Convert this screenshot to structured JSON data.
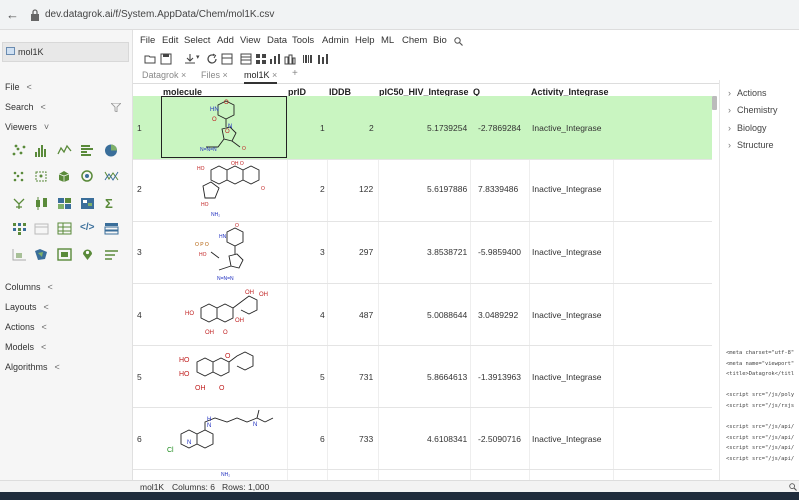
{
  "browser": {
    "url": "dev.datagrok.ai/f/System.AppData/Chem/mol1K.csv"
  },
  "left": {
    "doc_title": "mol1K",
    "sections": {
      "file": "File",
      "search": "Search",
      "viewers": "Viewers",
      "columns": "Columns",
      "layouts": "Layouts",
      "actions": "Actions",
      "models": "Models",
      "algorithms": "Algorithms"
    }
  },
  "menu": [
    "File",
    "Edit",
    "Select",
    "Add",
    "View",
    "Data",
    "Tools",
    "Admin",
    "Help",
    "ML",
    "Chem",
    "Bio"
  ],
  "tabs": {
    "t1": "Datagrok",
    "t2": "Files",
    "t3": "mol1K",
    "add": "+"
  },
  "grid": {
    "columns": [
      "molecule",
      "prID",
      "IDDB",
      "pIC50_HIV_Integrase",
      "Q",
      "Activity_Integrase"
    ],
    "rows": [
      {
        "n": "1",
        "prid": "1",
        "iddb": "2",
        "pic50": "5.1739254",
        "q": "-2.7869284",
        "act": "Inactive_Integrase"
      },
      {
        "n": "2",
        "prid": "2",
        "iddb": "122",
        "pic50": "5.6197886",
        "q": "7.8339486",
        "act": "Inactive_Integrase"
      },
      {
        "n": "3",
        "prid": "3",
        "iddb": "297",
        "pic50": "3.8538721",
        "q": "-5.9859400",
        "act": "Inactive_Integrase"
      },
      {
        "n": "4",
        "prid": "4",
        "iddb": "487",
        "pic50": "5.0088644",
        "q": "3.0489292",
        "act": "Inactive_Integrase"
      },
      {
        "n": "5",
        "prid": "5",
        "iddb": "731",
        "pic50": "5.8664613",
        "q": "-1.3913963",
        "act": "Inactive_Integrase"
      },
      {
        "n": "6",
        "prid": "6",
        "iddb": "733",
        "pic50": "4.6108341",
        "q": "-2.5090716",
        "act": "Inactive_Integrase"
      }
    ]
  },
  "right": {
    "sections": [
      "Actions",
      "Chemistry",
      "Biology",
      "Structure"
    ],
    "code": "<meta charset=\"utf-8\"\n<meta name=\"viewport\"\n<title>Datagrok</titl\n\n<script src=\"/js/poly\n<script src=\"/js/rxjs\n\n<script src=\"/js/api/\n<script src=\"/js/api/\n<script src=\"/js/api/\n<script src=\"/js/api/"
  },
  "status": {
    "table": "mol1K",
    "columns": "Columns: 6",
    "rows": "Rows: 1,000"
  },
  "colors": {
    "selected_row": "#c9f5c1",
    "accent": "#2c72b3"
  },
  "icons": [
    "back-icon",
    "lock-icon",
    "search-icon",
    "filter-icon"
  ]
}
